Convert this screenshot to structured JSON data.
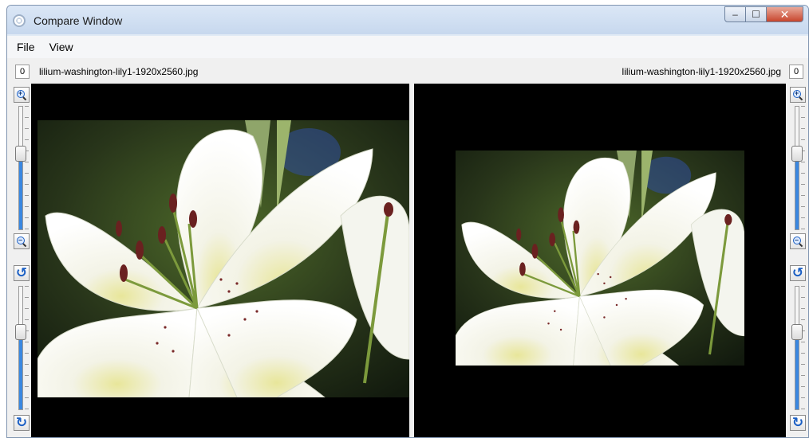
{
  "window": {
    "title": "Compare Window"
  },
  "title_buttons": {
    "minimize": "–",
    "maximize": "☐",
    "close": "✕"
  },
  "menu": {
    "items": [
      "File",
      "View"
    ]
  },
  "left_pane": {
    "counter": "0",
    "filename": "lilium-washington-lily1-1920x2560.jpg",
    "zoom_level": 0.37,
    "rotation_level": 0.35
  },
  "right_pane": {
    "counter": "0",
    "filename": "lilium-washington-lily1-1920x2560.jpg",
    "zoom_level": 0.37,
    "rotation_level": 0.35
  },
  "icons": {
    "zoom_in": "zoom-in-icon",
    "zoom_out": "zoom-out-icon",
    "rotate_left": "rotate-left-icon",
    "rotate_right": "rotate-right-icon",
    "zoom_in_glyph": "+",
    "zoom_out_glyph": "–",
    "rotate_left_glyph": "↺",
    "rotate_right_glyph": "↻"
  },
  "colors": {
    "accent": "#3a87e0",
    "viewer_bg": "#000000",
    "close": "#c7452c"
  }
}
